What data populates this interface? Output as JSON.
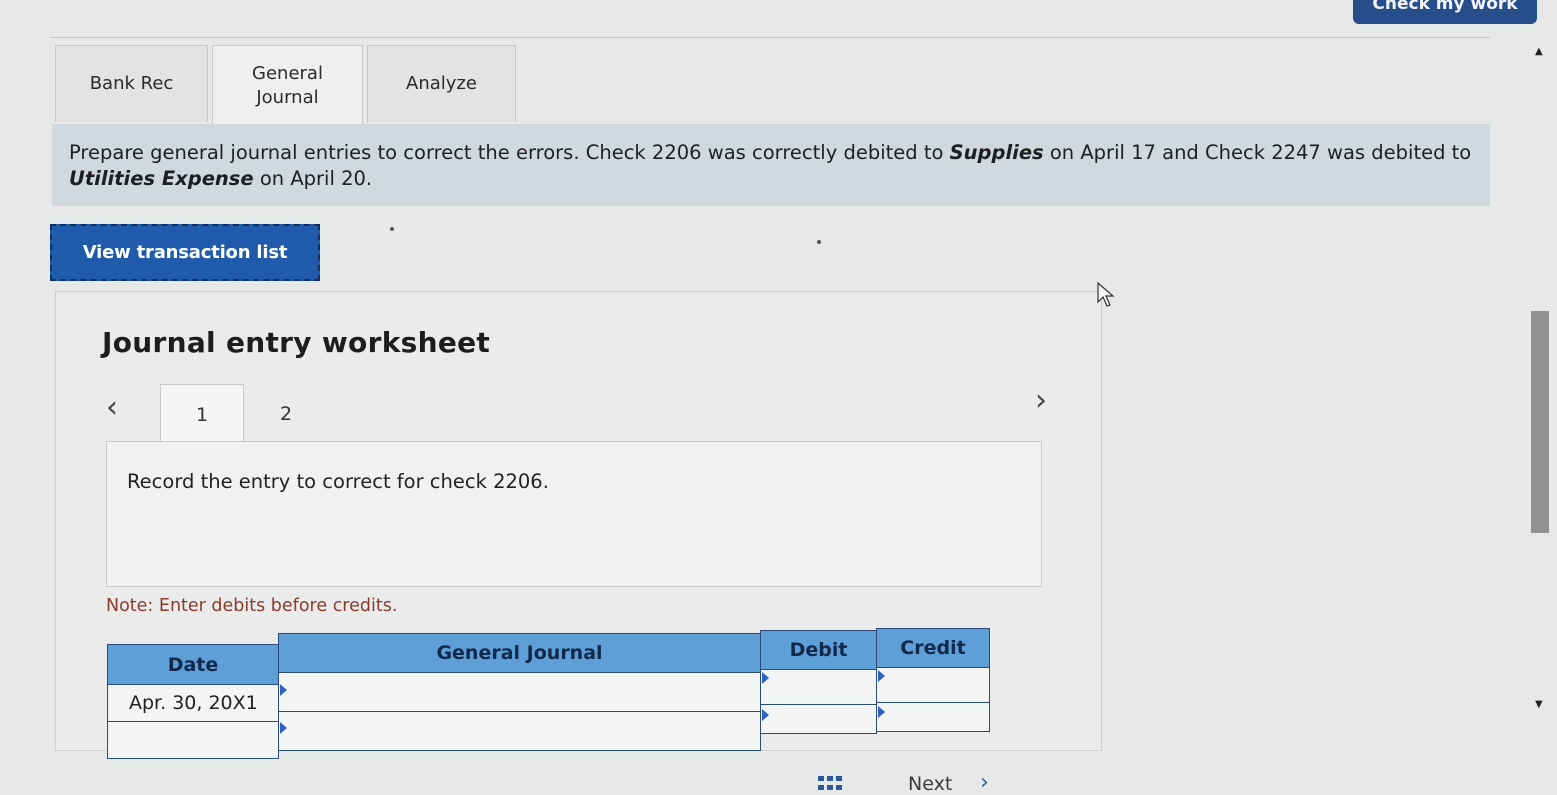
{
  "header": {
    "check_label": "Check my work"
  },
  "tabs": [
    {
      "label": "Bank Rec",
      "active": false
    },
    {
      "label_line1": "General",
      "label_line2": "Journal",
      "active": true
    },
    {
      "label": "Analyze",
      "active": false
    }
  ],
  "instruction": {
    "part1": "Prepare general journal entries to correct the errors. Check 2206 was correctly debited to ",
    "bold1": "Supplies",
    "part2": " on April 17 and Check 2247 was debited to ",
    "bold2": "Utilities Expense",
    "part3": " on April 20."
  },
  "view_transaction_label": "View transaction list",
  "worksheet": {
    "title": "Journal entry worksheet",
    "pages": [
      "1",
      "2"
    ],
    "active_page": "1",
    "prompt": "Record the entry to correct for check 2206.",
    "note": "Note: Enter debits before credits.",
    "table": {
      "headers": {
        "date": "Date",
        "journal": "General Journal",
        "debit": "Debit",
        "credit": "Credit"
      },
      "rows": [
        {
          "date": "Apr. 30, 20X1",
          "account": "",
          "debit": "",
          "credit": ""
        },
        {
          "date": "",
          "account": "",
          "debit": "",
          "credit": ""
        }
      ]
    }
  },
  "footer": {
    "next_label": "Next"
  },
  "icons": {
    "prev": "chevron-left-icon",
    "next": "chevron-right-icon",
    "grid": "grid-icon",
    "cursor": "mouse-cursor-icon"
  },
  "colors": {
    "header_blue": "#5e9fd8",
    "button_blue": "#1f5baa",
    "instruction_bg": "#cfd9de",
    "note_red": "#8a3b2c"
  }
}
